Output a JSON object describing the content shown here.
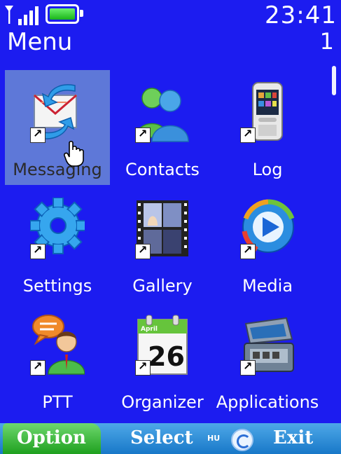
{
  "status": {
    "time": "23:41",
    "icons": [
      "antenna-icon",
      "signal-strength-icon",
      "battery-icon"
    ],
    "battery_color": "#22c822"
  },
  "header": {
    "title": "Menu",
    "page": "1"
  },
  "menu": {
    "selected_index": 0,
    "items": [
      {
        "label": "Messaging",
        "icon": "messaging-icon"
      },
      {
        "label": "Contacts",
        "icon": "contacts-icon"
      },
      {
        "label": "Log",
        "icon": "log-icon"
      },
      {
        "label": "Settings",
        "icon": "settings-icon"
      },
      {
        "label": "Gallery",
        "icon": "gallery-icon"
      },
      {
        "label": "Media",
        "icon": "media-icon"
      },
      {
        "label": "PTT",
        "icon": "ptt-icon"
      },
      {
        "label": "Organizer",
        "icon": "organizer-icon"
      },
      {
        "label": "Applications",
        "icon": "applications-icon"
      }
    ],
    "organizer_day": "26",
    "organizer_month": "April"
  },
  "softkeys": {
    "left": "Option",
    "middle": "Select",
    "right": "Exit",
    "badge": "HU"
  },
  "colors": {
    "background": "#1c1cf0",
    "selection": "#5e78d8",
    "softkey_left": "#1ea01e",
    "softkey_bar": "#1878c8"
  }
}
